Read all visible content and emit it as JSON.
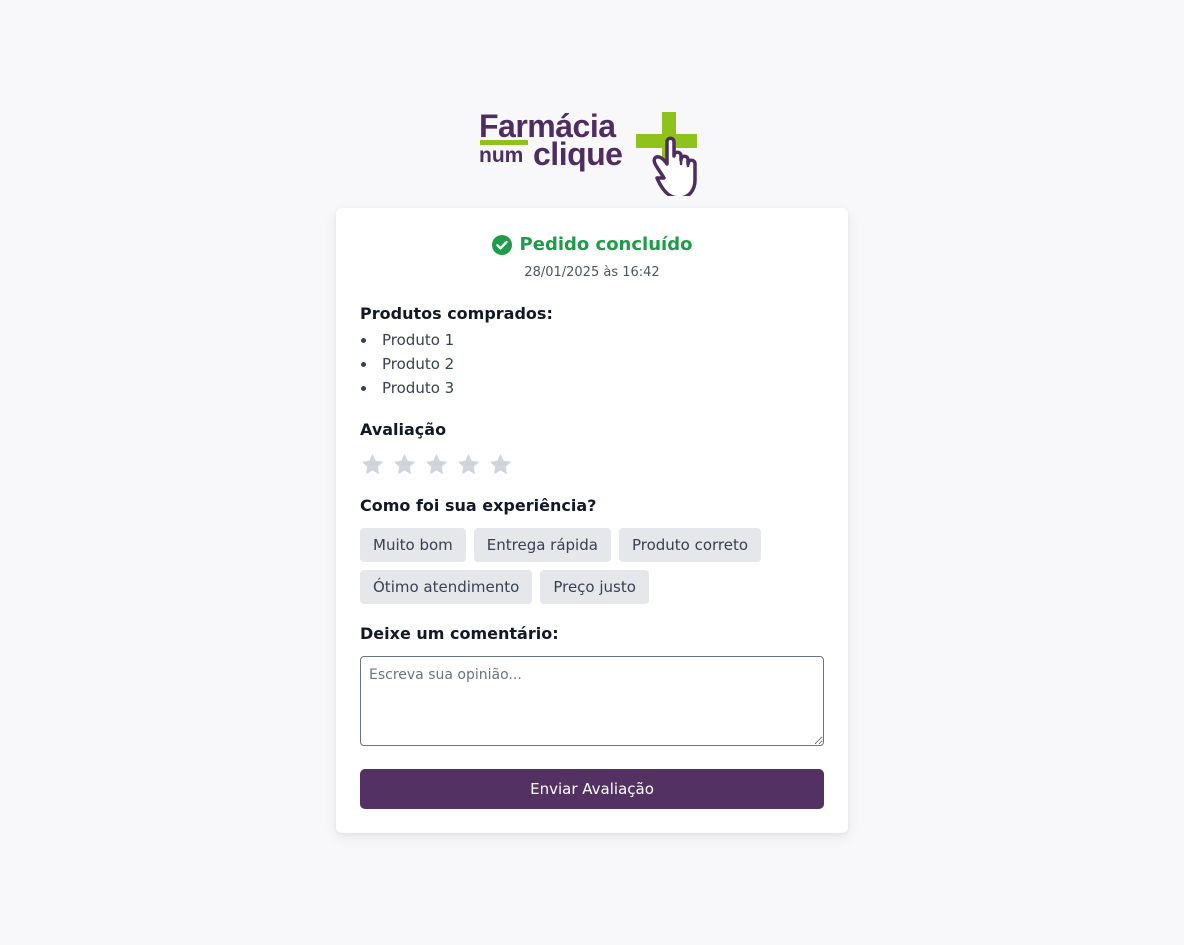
{
  "brand": {
    "line1": "Farmácia",
    "line2_small": "num",
    "line2_large": "clique",
    "colors": {
      "primary": "#4f2d62",
      "accent": "#8fc21b"
    },
    "icon": "pharmacy-cross-click-icon"
  },
  "order": {
    "status": "Pedido concluído",
    "status_icon": "check-circle-icon",
    "status_color": "#1e9c49",
    "timestamp": "28/01/2025 às 16:42"
  },
  "products": {
    "heading": "Produtos comprados:",
    "items": [
      "Produto 1",
      "Produto 2",
      "Produto 3"
    ]
  },
  "rating": {
    "heading": "Avaliação",
    "max_stars": 5,
    "selected": 0,
    "star_color": "#d1d5db"
  },
  "experience": {
    "heading": "Como foi sua experiência?",
    "tags": [
      "Muito bom",
      "Entrega rápida",
      "Produto correto",
      "Ótimo atendimento",
      "Preço justo"
    ]
  },
  "comment": {
    "heading": "Deixe um comentário:",
    "placeholder": "Escreva sua opinião...",
    "value": ""
  },
  "submit": {
    "label": "Enviar Avaliação",
    "color": "#533163"
  }
}
